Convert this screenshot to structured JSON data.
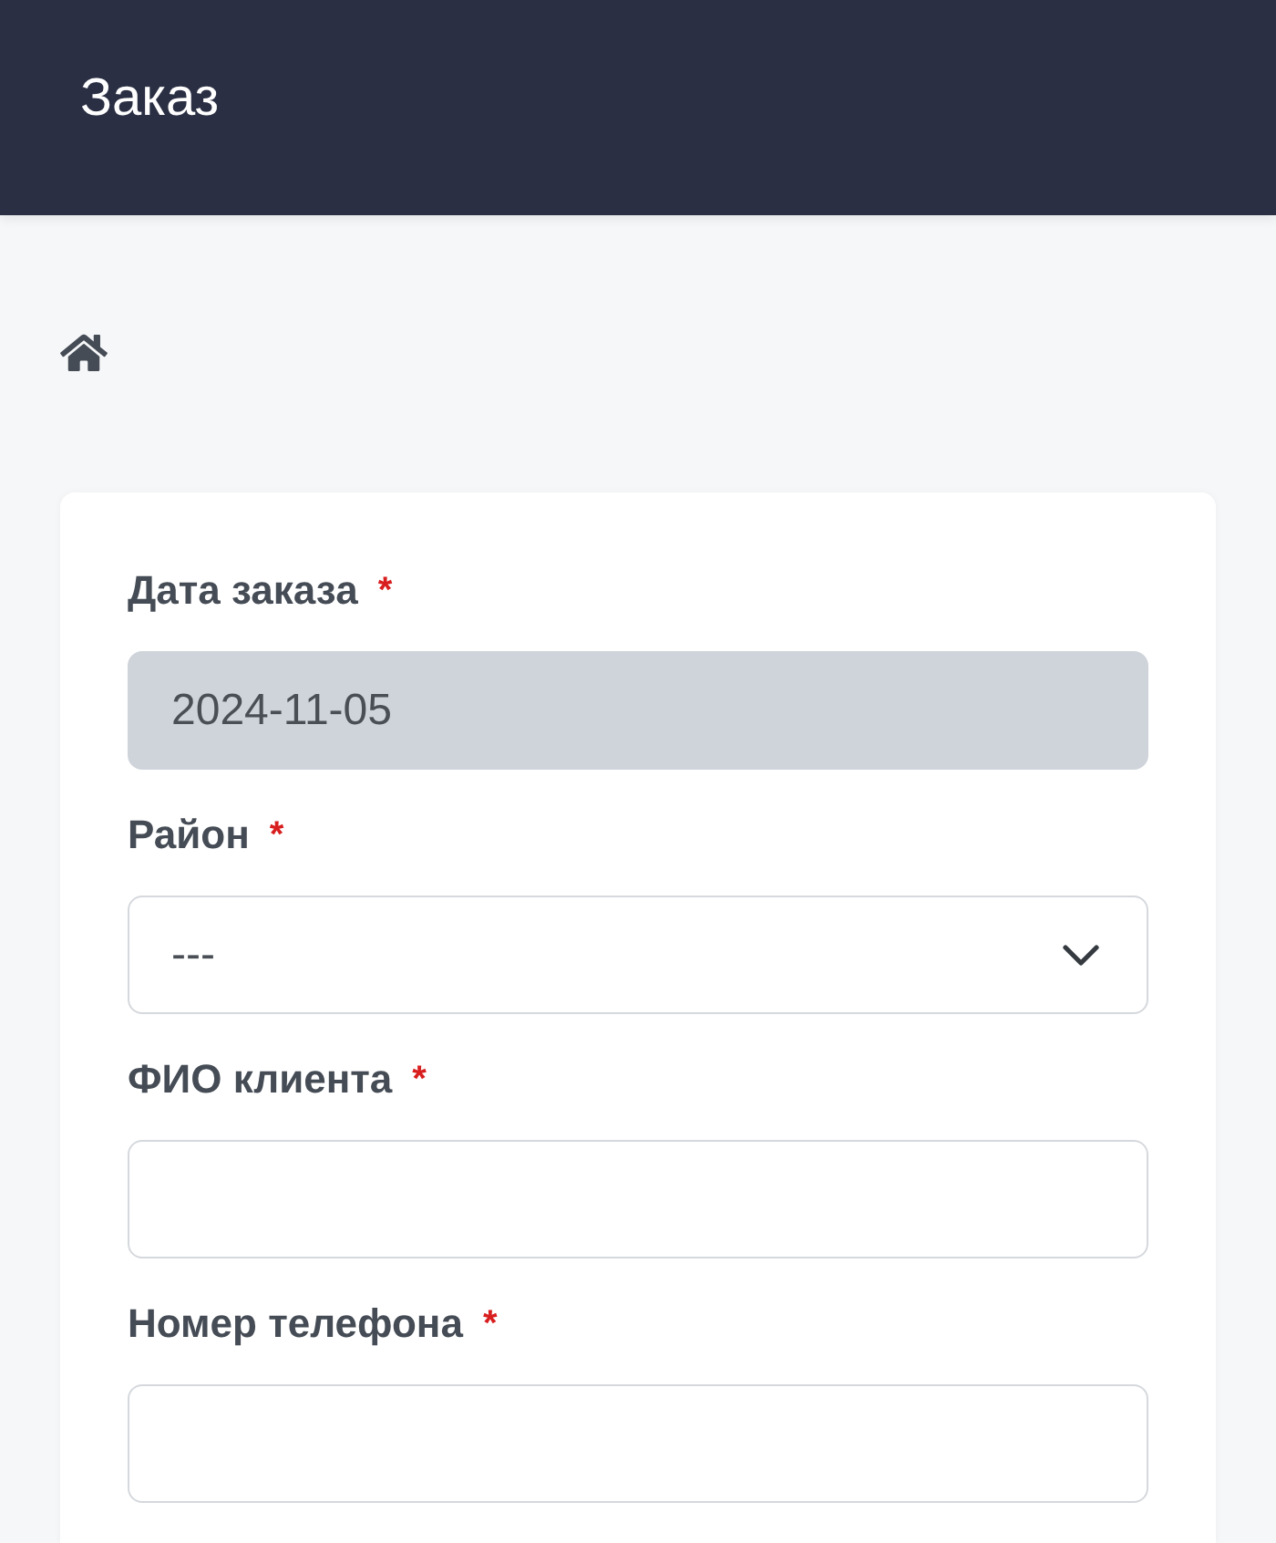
{
  "header": {
    "title": "Заказ"
  },
  "form": {
    "fields": [
      {
        "kind": "date",
        "label": "Дата заказа",
        "required_mark": "*",
        "value": "2024-11-05",
        "disabled": true
      },
      {
        "kind": "select",
        "label": "Район",
        "required_mark": "*",
        "value": "---",
        "disabled": false
      },
      {
        "kind": "text",
        "label": "ФИО клиента",
        "required_mark": "*",
        "disabled": false
      },
      {
        "kind": "text",
        "label": "Номер телефона",
        "required_mark": "*",
        "disabled": false
      }
    ]
  }
}
